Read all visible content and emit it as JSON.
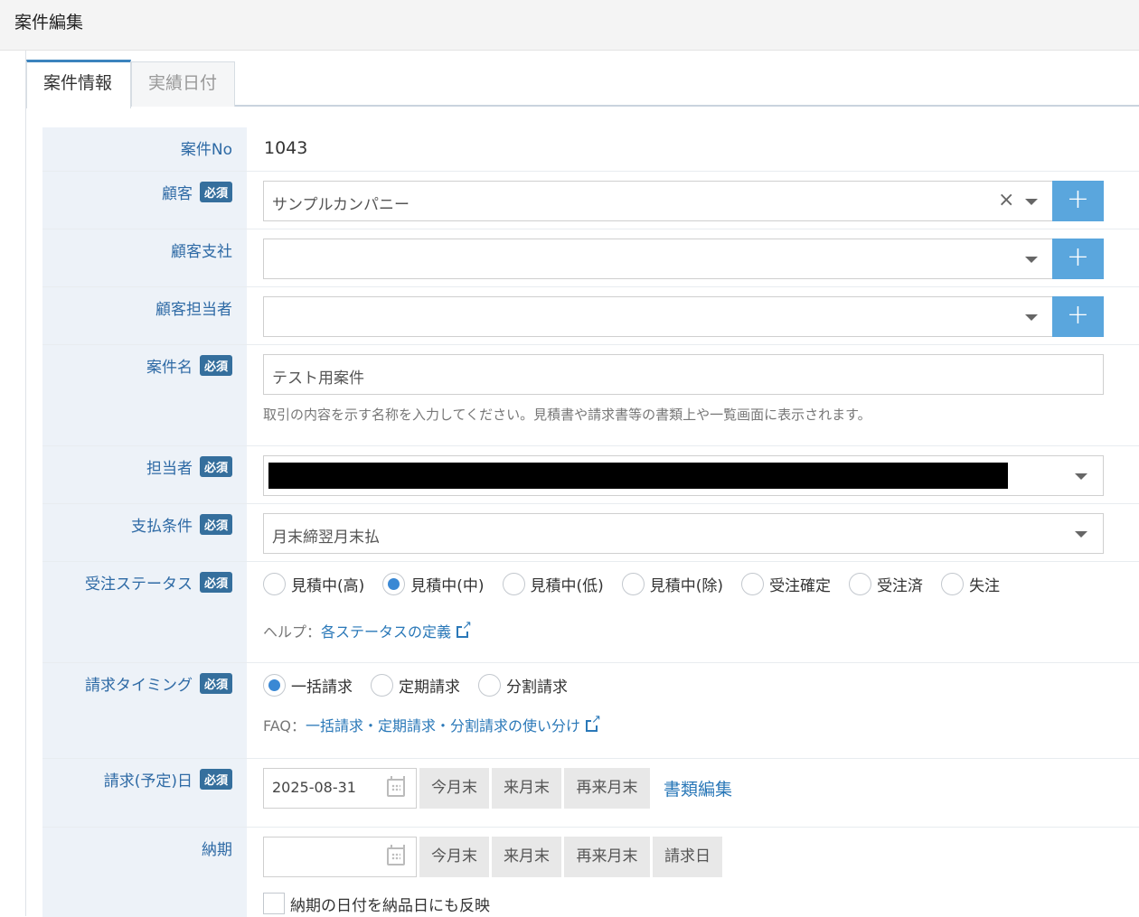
{
  "page": {
    "title": "案件編集"
  },
  "tabs": [
    {
      "label": "案件情報"
    },
    {
      "label": "実績日付"
    }
  ],
  "form": {
    "case_no": {
      "label": "案件No",
      "value": "1043"
    },
    "customer": {
      "label": "顧客",
      "value": "サンプルカンパニー"
    },
    "branch": {
      "label": "顧客支社",
      "value": ""
    },
    "contact": {
      "label": "顧客担当者",
      "value": ""
    },
    "case_name": {
      "label": "案件名",
      "value": "テスト用案件",
      "hint": "取引の内容を示す名称を入力してください。見積書や請求書等の書類上や一覧画面に表示されます。"
    },
    "owner": {
      "label": "担当者"
    },
    "payment": {
      "label": "支払条件",
      "value": "月末締翌月末払"
    },
    "status": {
      "label": "受注ステータス",
      "options": [
        "見積中(高)",
        "見積中(中)",
        "見積中(低)",
        "見積中(除)",
        "受注確定",
        "受注済",
        "失注"
      ],
      "help_prefix": "ヘルプ：",
      "help_link": "各ステータスの定義"
    },
    "billing_timing": {
      "label": "請求タイミング",
      "options": [
        "一括請求",
        "定期請求",
        "分割請求"
      ],
      "faq_prefix": "FAQ：",
      "faq_link": "一括請求・定期請求・分割請求の使い分け"
    },
    "billing_date": {
      "label": "請求(予定)日",
      "value": "2025-08-31",
      "buttons": [
        "今月末",
        "来月末",
        "再来月末"
      ],
      "doc_link": "書類編集"
    },
    "delivery": {
      "label": "納期",
      "value": "",
      "buttons": [
        "今月末",
        "来月末",
        "再来月末",
        "請求日"
      ],
      "checkbox_label": "納期の日付を納品日にも反映"
    },
    "required_badge": "必須"
  }
}
